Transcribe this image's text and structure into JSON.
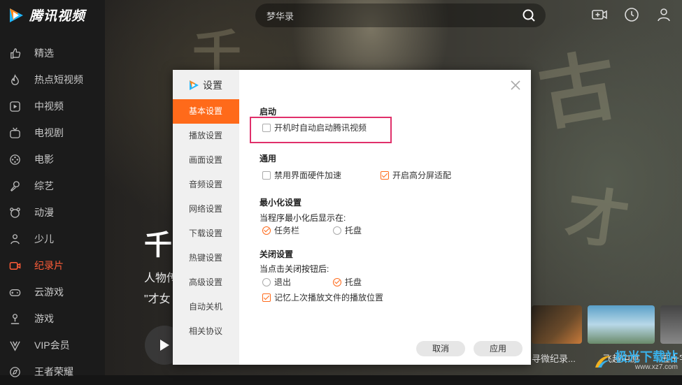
{
  "app": {
    "title": "腾讯视频"
  },
  "sidebar": {
    "items": [
      {
        "label": "精选",
        "icon": "thumb-up-icon"
      },
      {
        "label": "热点短视频",
        "icon": "flame-icon"
      },
      {
        "label": "中视频",
        "icon": "play-square-icon"
      },
      {
        "label": "电视剧",
        "icon": "tv-icon"
      },
      {
        "label": "电影",
        "icon": "film-reel-icon"
      },
      {
        "label": "综艺",
        "icon": "microphone-icon"
      },
      {
        "label": "动漫",
        "icon": "bear-face-icon"
      },
      {
        "label": "少儿",
        "icon": "child-icon"
      },
      {
        "label": "纪录片",
        "icon": "camera-icon",
        "active": true
      },
      {
        "label": "云游戏",
        "icon": "gamepad-icon"
      },
      {
        "label": "游戏",
        "icon": "joystick-icon"
      },
      {
        "label": "VIP会员",
        "icon": "vip-icon"
      },
      {
        "label": "王者荣耀",
        "icon": "compass-icon"
      }
    ]
  },
  "header": {
    "search_value": "梦华录"
  },
  "hero": {
    "title": "千",
    "line1": "人物传",
    "line2": "\"才女"
  },
  "thumbs": [
    {
      "caption": "寻微纪录..."
    },
    {
      "caption": "飞越中原"
    },
    {
      "caption": "五十字"
    }
  ],
  "watermark": {
    "text": "极光下载站",
    "url": "www.xz7.com"
  },
  "dialog": {
    "title": "设置",
    "tabs": [
      "基本设置",
      "播放设置",
      "画面设置",
      "音频设置",
      "网络设置",
      "下载设置",
      "热键设置",
      "高级设置",
      "自动关机",
      "相关协议"
    ],
    "active_tab": "基本设置",
    "sections": {
      "startup": {
        "heading": "启动",
        "autostart": "开机时自动启动腾讯视频"
      },
      "general": {
        "heading": "通用",
        "disable_hw": "禁用界面硬件加速",
        "high_dpi": "开启高分屏适配"
      },
      "minimize": {
        "heading": "最小化设置",
        "desc": "当程序最小化后显示在:",
        "taskbar": "任务栏",
        "tray": "托盘"
      },
      "close": {
        "heading": "关闭设置",
        "desc": "当点击关闭按钮后:",
        "exit": "退出",
        "tray": "托盘",
        "remember": "记忆上次播放文件的播放位置"
      }
    },
    "states": {
      "autostart": false,
      "disable_hw": false,
      "high_dpi": true,
      "minimize_to": "taskbar",
      "close_action": "tray",
      "remember": true
    },
    "buttons": {
      "cancel": "取消",
      "apply": "应用"
    }
  },
  "colors": {
    "accent": "#ff6a1a",
    "highlight_box": "#e0306a",
    "nav_active": "#ff5c38"
  }
}
